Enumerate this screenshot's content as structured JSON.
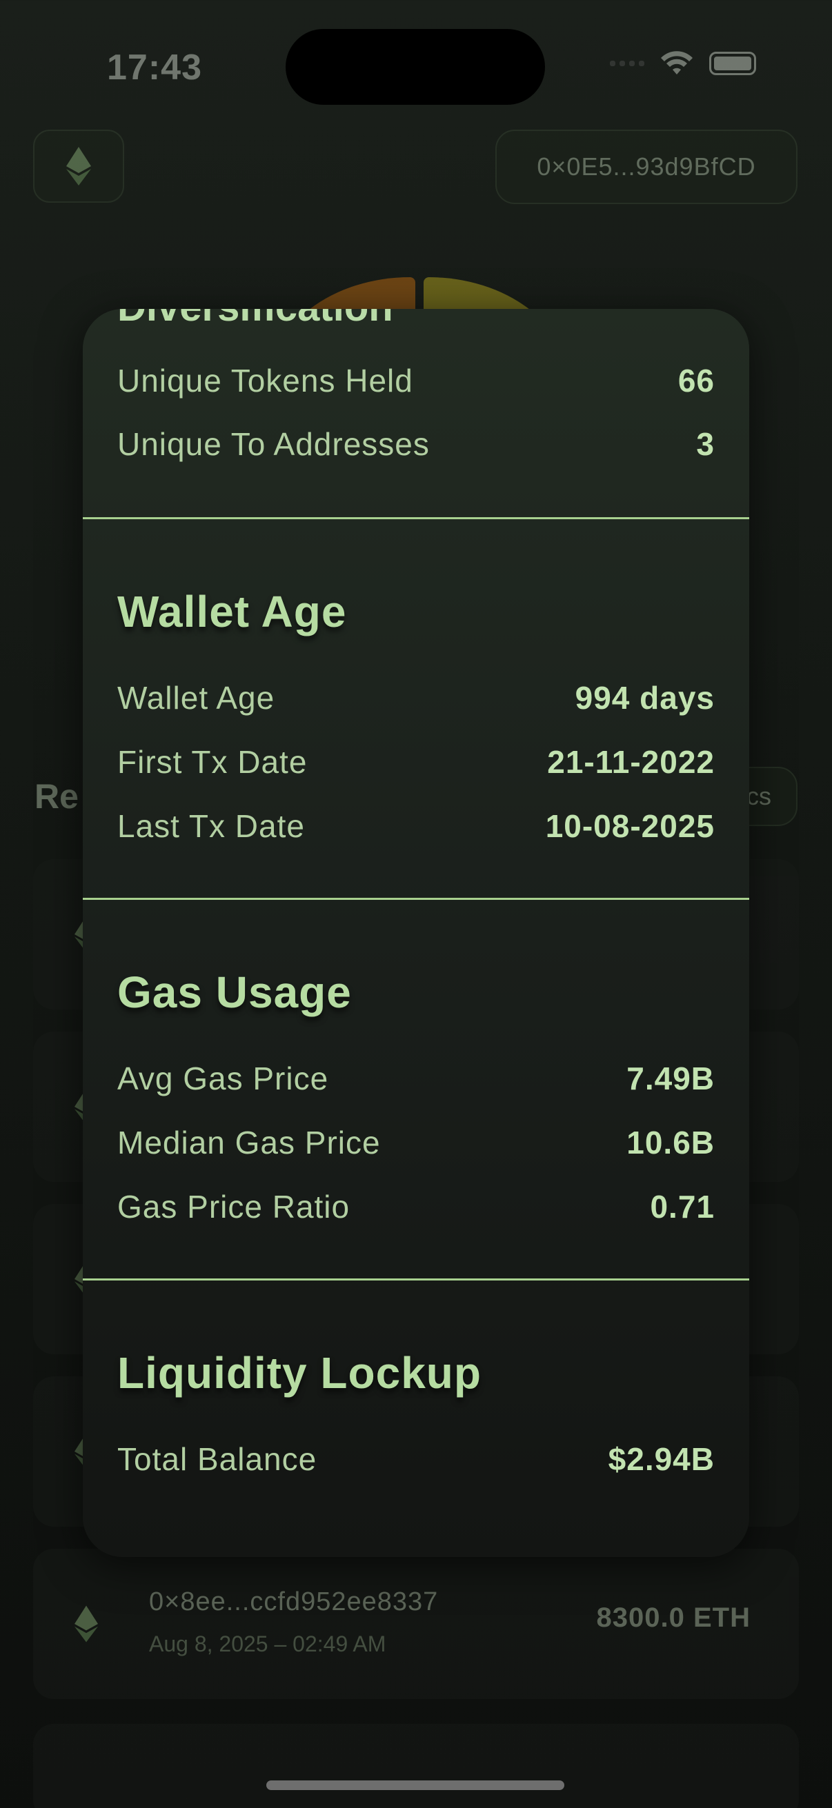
{
  "status_bar": {
    "time": "17:43"
  },
  "header": {
    "wallet_address": "0×0E5...93d9BfCD"
  },
  "background": {
    "recent_title_partial": "Re",
    "metrics_button_partial": "cs",
    "last_tx": {
      "hash": "0×8ee...ccfd952ee8337",
      "date": "Aug 8, 2025 – 02:49 AM",
      "amount": "8300.0 ETH"
    }
  },
  "modal": {
    "diversification": {
      "rows": [
        {
          "label": "Unique Tokens Held",
          "value": "66"
        },
        {
          "label": "Unique To Addresses",
          "value": "3"
        }
      ]
    },
    "wallet_age": {
      "title": "Wallet Age",
      "rows": [
        {
          "label": "Wallet Age",
          "value": "994 days"
        },
        {
          "label": "First Tx Date",
          "value": "21-11-2022"
        },
        {
          "label": "Last Tx Date",
          "value": "10-08-2025"
        }
      ]
    },
    "gas_usage": {
      "title": "Gas Usage",
      "rows": [
        {
          "label": "Avg Gas Price",
          "value": "7.49B"
        },
        {
          "label": "Median Gas Price",
          "value": "10.6B"
        },
        {
          "label": "Gas Price Ratio",
          "value": "0.71"
        }
      ]
    },
    "liquidity_lockup": {
      "title": "Liquidity Lockup",
      "rows": [
        {
          "label": "Total Balance",
          "value": "$2.94B"
        }
      ]
    }
  },
  "colors": {
    "accent_green": "#b6dca2",
    "divider_green": "#a8d18f",
    "pie_orange": "#e07b10",
    "pie_yellow": "#d4c020"
  },
  "icons": [
    "ethereum-icon",
    "wifi-icon",
    "battery-icon",
    "cellular-signal-icon"
  ]
}
